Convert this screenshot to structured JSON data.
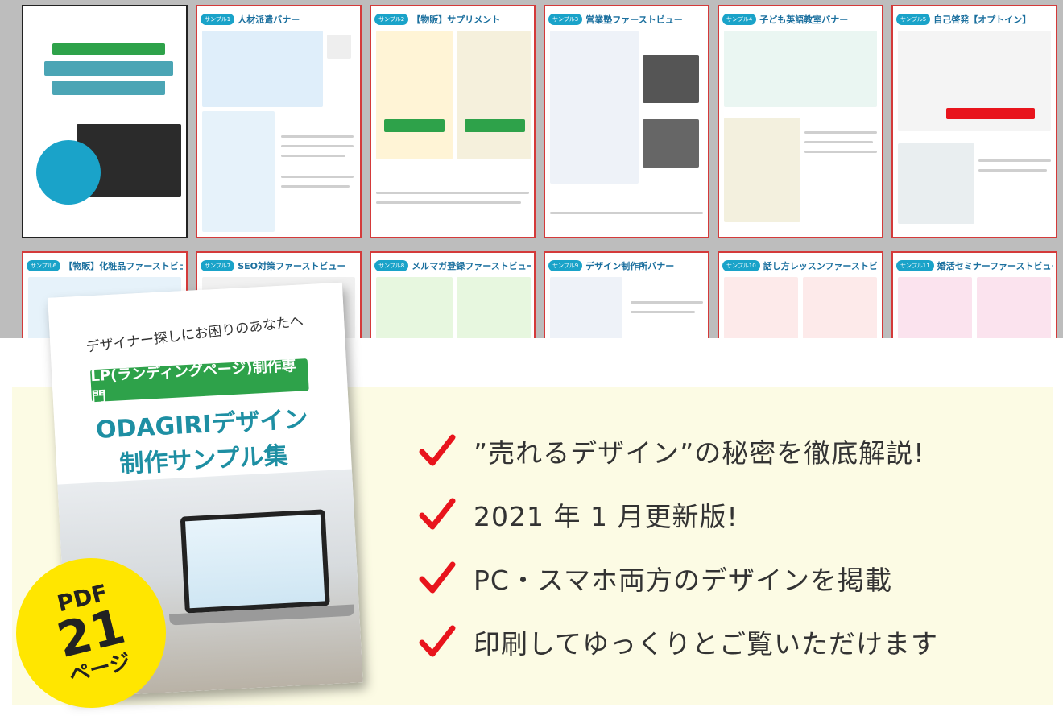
{
  "thumbnails": {
    "row1": [
      {
        "badge": "",
        "title": ""
      },
      {
        "badge": "サンプル1",
        "title": "人材派遣バナー"
      },
      {
        "badge": "サンプル2",
        "title": "【物販】サプリメント"
      },
      {
        "badge": "サンプル3",
        "title": "営業塾ファーストビュー"
      },
      {
        "badge": "サンプル4",
        "title": "子ども英語教室バナー"
      },
      {
        "badge": "サンプル5",
        "title": "自己啓発【オプトイン】"
      }
    ],
    "row2": [
      {
        "badge": "サンプル6",
        "title": "【物販】化粧品ファーストビュー"
      },
      {
        "badge": "サンプル7",
        "title": "SEO対策ファーストビュー"
      },
      {
        "badge": "サンプル8",
        "title": "メルマガ登録ファーストビュー"
      },
      {
        "badge": "サンプル9",
        "title": "デザイン制作所バナー"
      },
      {
        "badge": "サンプル10",
        "title": "話し方レッスンファーストビュー"
      },
      {
        "badge": "サンプル11",
        "title": "婚活セミナーファーストビュー"
      }
    ]
  },
  "cover": {
    "subtitle": "デザイナー探しにお困りのあなたへ",
    "tag": "LP(ランディングページ)制作専門",
    "title_line1": "ODAGIRIデザイン",
    "title_line2": "制作サンプル集"
  },
  "pdf_badge": {
    "line1": "PDF",
    "line2": "21",
    "line3": "ページ"
  },
  "bullets": [
    "”売れるデザイン”の秘密を徹底解説!",
    "2021 年 1 月更新版!",
    "PC・スマホ両方のデザインを掲載",
    "印刷してゆっくりとご覧いただけます"
  ],
  "colors": {
    "check": "#e8141c",
    "accent": "#1e8fa3",
    "tag": "#2ea24a",
    "badge": "#ffe600"
  }
}
